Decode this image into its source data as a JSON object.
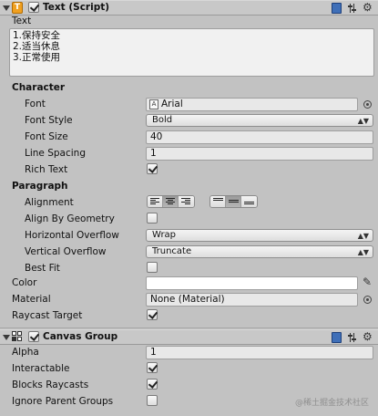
{
  "text_component": {
    "title": "Text (Script)",
    "enabled": true,
    "text_label": "Text",
    "text_lines": [
      "1.保持安全",
      "2.适当休息",
      "3.正常使用"
    ],
    "character_header": "Character",
    "font_label": "Font",
    "font_value": "Arial",
    "font_style_label": "Font Style",
    "font_style_value": "Bold",
    "font_size_label": "Font Size",
    "font_size_value": "40",
    "line_spacing_label": "Line Spacing",
    "line_spacing_value": "1",
    "rich_text_label": "Rich Text",
    "rich_text_checked": true,
    "paragraph_header": "Paragraph",
    "alignment_label": "Alignment",
    "horizontal_alignment_selected": "center",
    "vertical_alignment_selected": "middle",
    "align_by_geometry_label": "Align By Geometry",
    "align_by_geometry_checked": false,
    "horizontal_overflow_label": "Horizontal Overflow",
    "horizontal_overflow_value": "Wrap",
    "vertical_overflow_label": "Vertical Overflow",
    "vertical_overflow_value": "Truncate",
    "best_fit_label": "Best Fit",
    "best_fit_checked": false,
    "color_label": "Color",
    "color_value": "#ffffff",
    "material_label": "Material",
    "material_value": "None (Material)",
    "raycast_target_label": "Raycast Target",
    "raycast_target_checked": true
  },
  "canvas_group": {
    "title": "Canvas Group",
    "enabled": true,
    "alpha_label": "Alpha",
    "alpha_value": "1",
    "interactable_label": "Interactable",
    "interactable_checked": true,
    "blocks_raycasts_label": "Blocks Raycasts",
    "blocks_raycasts_checked": true,
    "ignore_parent_groups_label": "Ignore Parent Groups",
    "ignore_parent_groups_checked": false
  },
  "watermark": "@稀土掘金技术社区",
  "icons": [
    "foldout-arrow-icon",
    "text-script-icon",
    "help-book-icon",
    "preset-sliders-icon",
    "settings-gear-icon",
    "font-asset-icon",
    "object-picker-icon",
    "eyedropper-icon",
    "canvas-group-icon"
  ]
}
